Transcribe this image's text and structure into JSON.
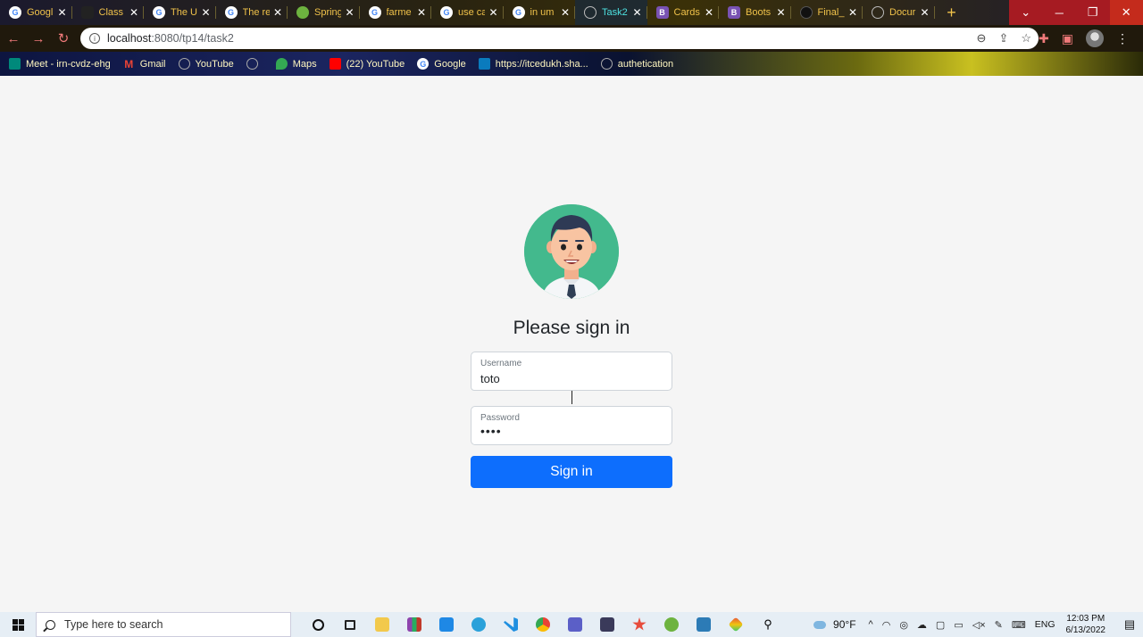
{
  "browser": {
    "tabs": [
      {
        "label": "Googl",
        "favicon": "google-icon",
        "active": false
      },
      {
        "label": "Class",
        "favicon": "classroom-icon",
        "active": false
      },
      {
        "label": "The U",
        "favicon": "google-icon",
        "active": false
      },
      {
        "label": "The re",
        "favicon": "google-icon",
        "active": false
      },
      {
        "label": "Spring",
        "favicon": "spring-icon",
        "active": false
      },
      {
        "label": "farme",
        "favicon": "google-icon",
        "active": false
      },
      {
        "label": "use ca",
        "favicon": "google-icon",
        "active": false
      },
      {
        "label": "in um",
        "favicon": "google-icon",
        "active": true
      },
      {
        "label": "Task2",
        "favicon": "globe-icon",
        "active": false
      },
      {
        "label": "Cards",
        "favicon": "bootstrap-icon",
        "active": false
      },
      {
        "label": "Boots",
        "favicon": "bootstrap-icon",
        "active": false
      },
      {
        "label": "Final_",
        "favicon": "github-icon",
        "active": false
      },
      {
        "label": "Docur",
        "favicon": "globe-icon",
        "active": false
      }
    ],
    "new_tab": "+",
    "url_host": "localhost",
    "url_path": ":8080/tp14/task2",
    "bookmarks": [
      {
        "label": "Meet - irn-cvdz-ehg",
        "icon": "meet-icon"
      },
      {
        "label": "Gmail",
        "icon": "gmail-icon"
      },
      {
        "label": "YouTube",
        "icon": "globe-icon"
      },
      {
        "label": "",
        "icon": "globe-icon"
      },
      {
        "label": "Maps",
        "icon": "maps-icon"
      },
      {
        "label": "(22) YouTube",
        "icon": "youtube-icon"
      },
      {
        "label": "Google",
        "icon": "google-icon"
      },
      {
        "label": "https://itcedukh.sha...",
        "icon": "sharepoint-icon"
      },
      {
        "label": "authetication",
        "icon": "globe-icon"
      }
    ]
  },
  "login": {
    "title": "Please sign in",
    "username_label": "Username",
    "username_value": "toto",
    "password_label": "Password",
    "password_value": "••••",
    "button_label": "Sign in"
  },
  "taskbar": {
    "search_placeholder": "Type here to search",
    "weather": "90°F",
    "lang": "ENG",
    "time": "12:03 PM",
    "date": "6/13/2022"
  },
  "colors": {
    "primary": "#0d6efd",
    "avatar_bg": "#43b98d",
    "page_bg": "#f5f5f5"
  }
}
